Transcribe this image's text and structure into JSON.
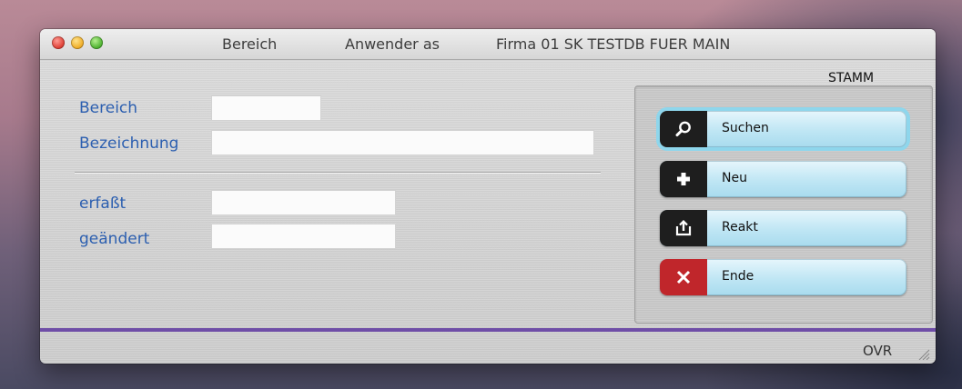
{
  "window": {
    "title_items": [
      "Bereich",
      "Anwender as",
      "Firma 01 SK TESTDB FUER MAIN"
    ]
  },
  "form": {
    "bereich_label": "Bereich",
    "bezeichnung_label": "Bezeichnung",
    "erfasst_label": "erfaßt",
    "geaendert_label": "geändert",
    "bereich_value": "",
    "bezeichnung_value": "",
    "erfasst_value": "",
    "geaendert_value": ""
  },
  "panel": {
    "title": "STAMM",
    "buttons": [
      {
        "label": "Suchen",
        "icon": "search-icon"
      },
      {
        "label": "Neu",
        "icon": "plus-icon"
      },
      {
        "label": "Reakt",
        "icon": "upload-icon"
      },
      {
        "label": "Ende",
        "icon": "close-icon"
      }
    ]
  },
  "status": {
    "mode": "OVR"
  },
  "colors": {
    "label_blue": "#2c5fb0",
    "footer_line": "#6f4ea7",
    "button_highlight": "#8ed6ec",
    "end_red": "#c0262b"
  }
}
